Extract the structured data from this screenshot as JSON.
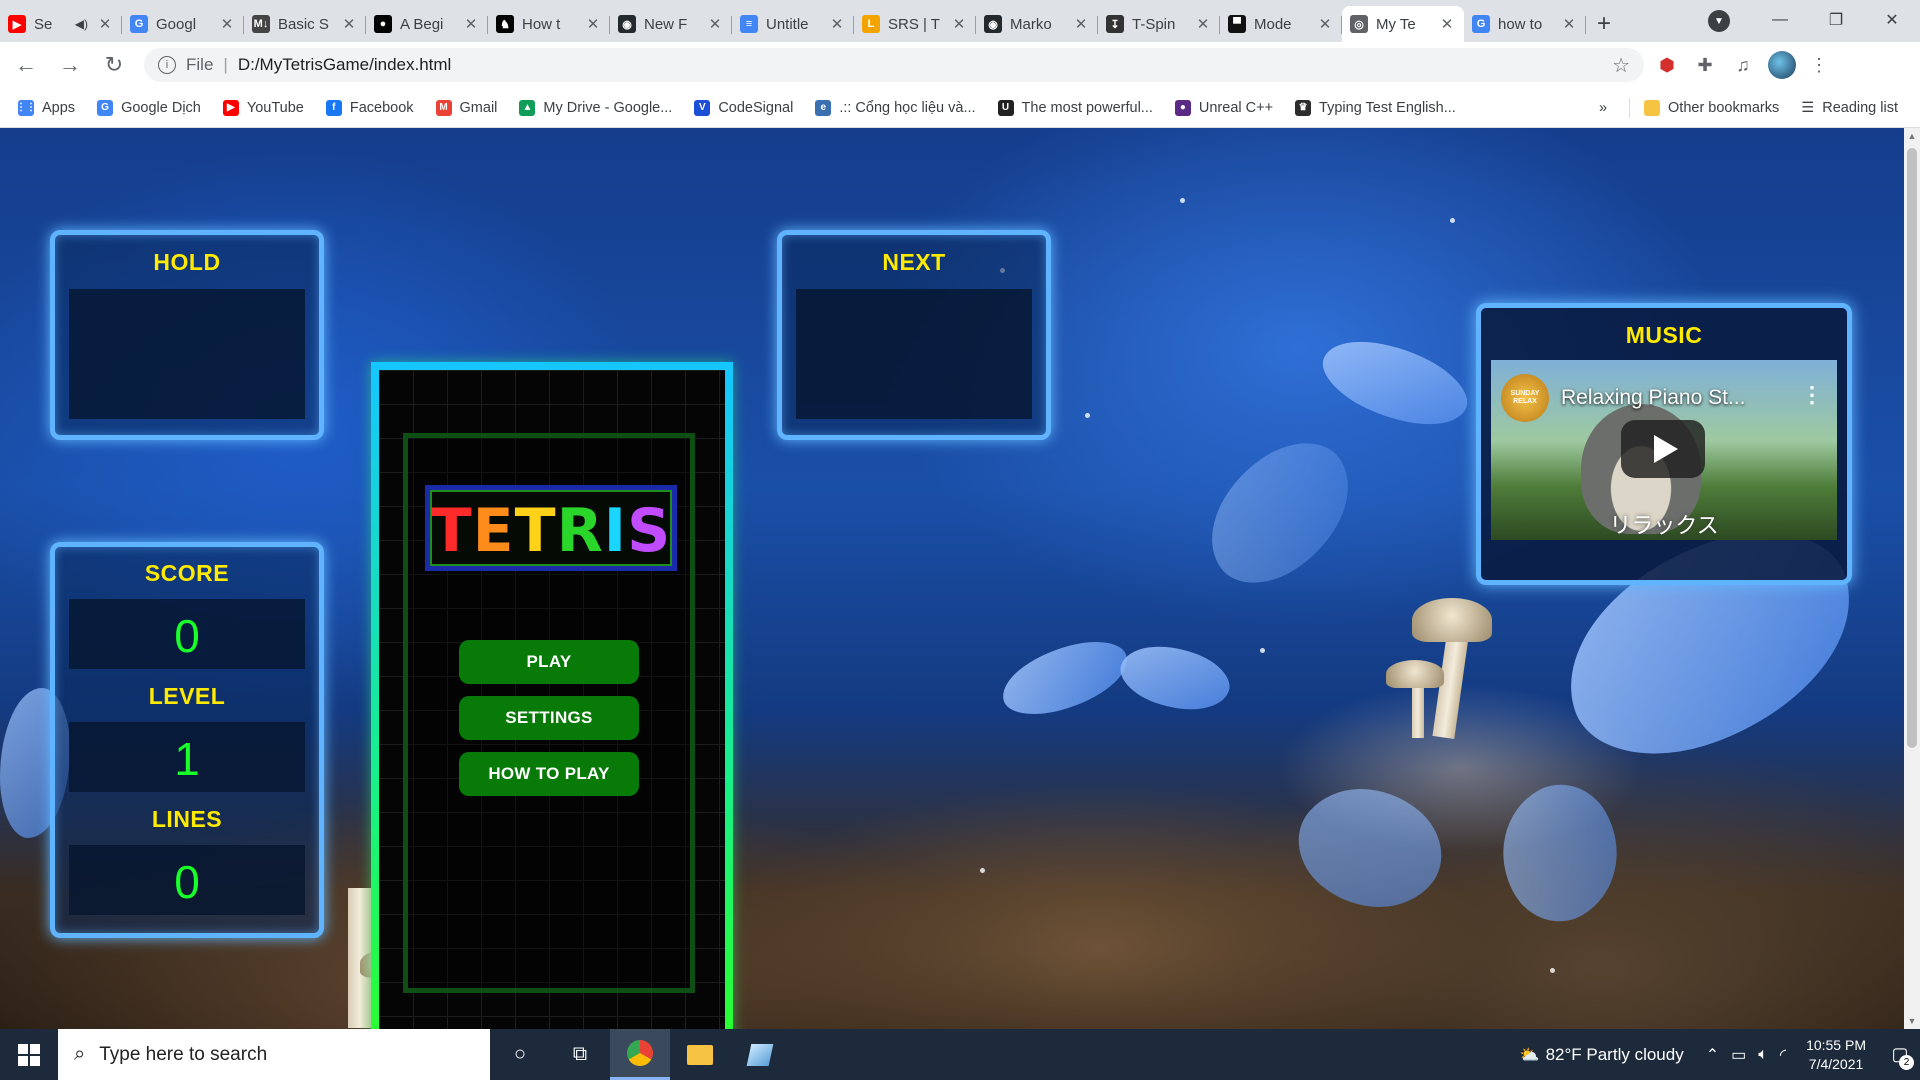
{
  "browser": {
    "tabs": [
      {
        "title": "Se",
        "fav_color": "#ff0000",
        "fav_glyph": "▶",
        "active": false,
        "muted_icon": "speaker-icon"
      },
      {
        "title": "Googl",
        "fav_color": "#4285f4",
        "fav_glyph": "G",
        "active": false
      },
      {
        "title": "Basic S",
        "fav_color": "#444444",
        "fav_glyph": "M↓",
        "active": false
      },
      {
        "title": "A Begi",
        "fav_color": "#000000",
        "fav_glyph": "●",
        "active": false
      },
      {
        "title": "How t",
        "fav_color": "#000000",
        "fav_glyph": "♞",
        "active": false
      },
      {
        "title": "New F",
        "fav_color": "#24292e",
        "fav_glyph": "◉",
        "active": false
      },
      {
        "title": "Untitle",
        "fav_color": "#4285f4",
        "fav_glyph": "≡",
        "active": false
      },
      {
        "title": "SRS | T",
        "fav_color": "#f4a400",
        "fav_glyph": "L",
        "active": false
      },
      {
        "title": "Marko",
        "fav_color": "#24292e",
        "fav_glyph": "◉",
        "active": false
      },
      {
        "title": "T-Spin",
        "fav_color": "#333333",
        "fav_glyph": "↧",
        "active": false
      },
      {
        "title": "Mode",
        "fav_color": "#111111",
        "fav_glyph": "▀",
        "active": false
      },
      {
        "title": "My Te",
        "fav_color": "#5f6368",
        "fav_glyph": "◎",
        "active": true
      },
      {
        "title": "how to",
        "fav_color": "#4285f4",
        "fav_glyph": "G",
        "active": false
      }
    ],
    "address": {
      "scheme": "File",
      "url": "D:/MyTetrisGame/index.html"
    },
    "bookmarks": [
      {
        "label": "Apps",
        "color": "#4285f4",
        "glyph": "⋮⋮"
      },
      {
        "label": "Google Dịch",
        "color": "#4285f4",
        "glyph": "G"
      },
      {
        "label": "YouTube",
        "color": "#ff0000",
        "glyph": "▶"
      },
      {
        "label": "Facebook",
        "color": "#1877f2",
        "glyph": "f"
      },
      {
        "label": "Gmail",
        "color": "#ea4335",
        "glyph": "M"
      },
      {
        "label": "My Drive - Google...",
        "color": "#0f9d58",
        "glyph": "▲"
      },
      {
        "label": "CodeSignal",
        "color": "#1a4fd6",
        "glyph": "V"
      },
      {
        "label": ".:: Cổng học liệu và...",
        "color": "#3a6fb0",
        "glyph": "e"
      },
      {
        "label": "The most powerful...",
        "color": "#222222",
        "glyph": "U"
      },
      {
        "label": "Unreal C++",
        "color": "#5b2a86",
        "glyph": "●"
      },
      {
        "label": "Typing Test English...",
        "color": "#2d2d2d",
        "glyph": "♛"
      }
    ],
    "bookmarks_overflow": "»",
    "other_bookmarks": "Other bookmarks",
    "reading_list": "Reading list"
  },
  "game": {
    "hold": {
      "title": "HOLD"
    },
    "next": {
      "title": "NEXT"
    },
    "score": {
      "title": "SCORE",
      "value": "0"
    },
    "level": {
      "title": "LEVEL",
      "value": "1"
    },
    "lines": {
      "title": "LINES",
      "value": "0"
    },
    "logo_letters": [
      {
        "ch": "T",
        "color": "#ff2a2a"
      },
      {
        "ch": "E",
        "color": "#ff8c1a"
      },
      {
        "ch": "T",
        "color": "#ffd21a"
      },
      {
        "ch": "R",
        "color": "#2bd62b"
      },
      {
        "ch": "I",
        "color": "#1ad6ff"
      },
      {
        "ch": "S",
        "color": "#c04bff"
      }
    ],
    "menu": {
      "play": "PLAY",
      "settings": "SETTINGS",
      "how_to_play": "HOW TO PLAY"
    }
  },
  "music": {
    "title": "MUSIC",
    "video_title": "Relaxing Piano St...",
    "channel_badge": "SUNDAY RELAX",
    "caption": "リラックス"
  },
  "taskbar": {
    "search_placeholder": "Type here to search",
    "weather": "82°F  Partly cloudy",
    "time": "10:55 PM",
    "date": "7/4/2021",
    "notifications": "2"
  },
  "colors": {
    "accent_yellow": "#ffea00",
    "stat_green": "#18ff2a",
    "button_green": "#077a07",
    "panel_border": "#5fb3ff"
  }
}
